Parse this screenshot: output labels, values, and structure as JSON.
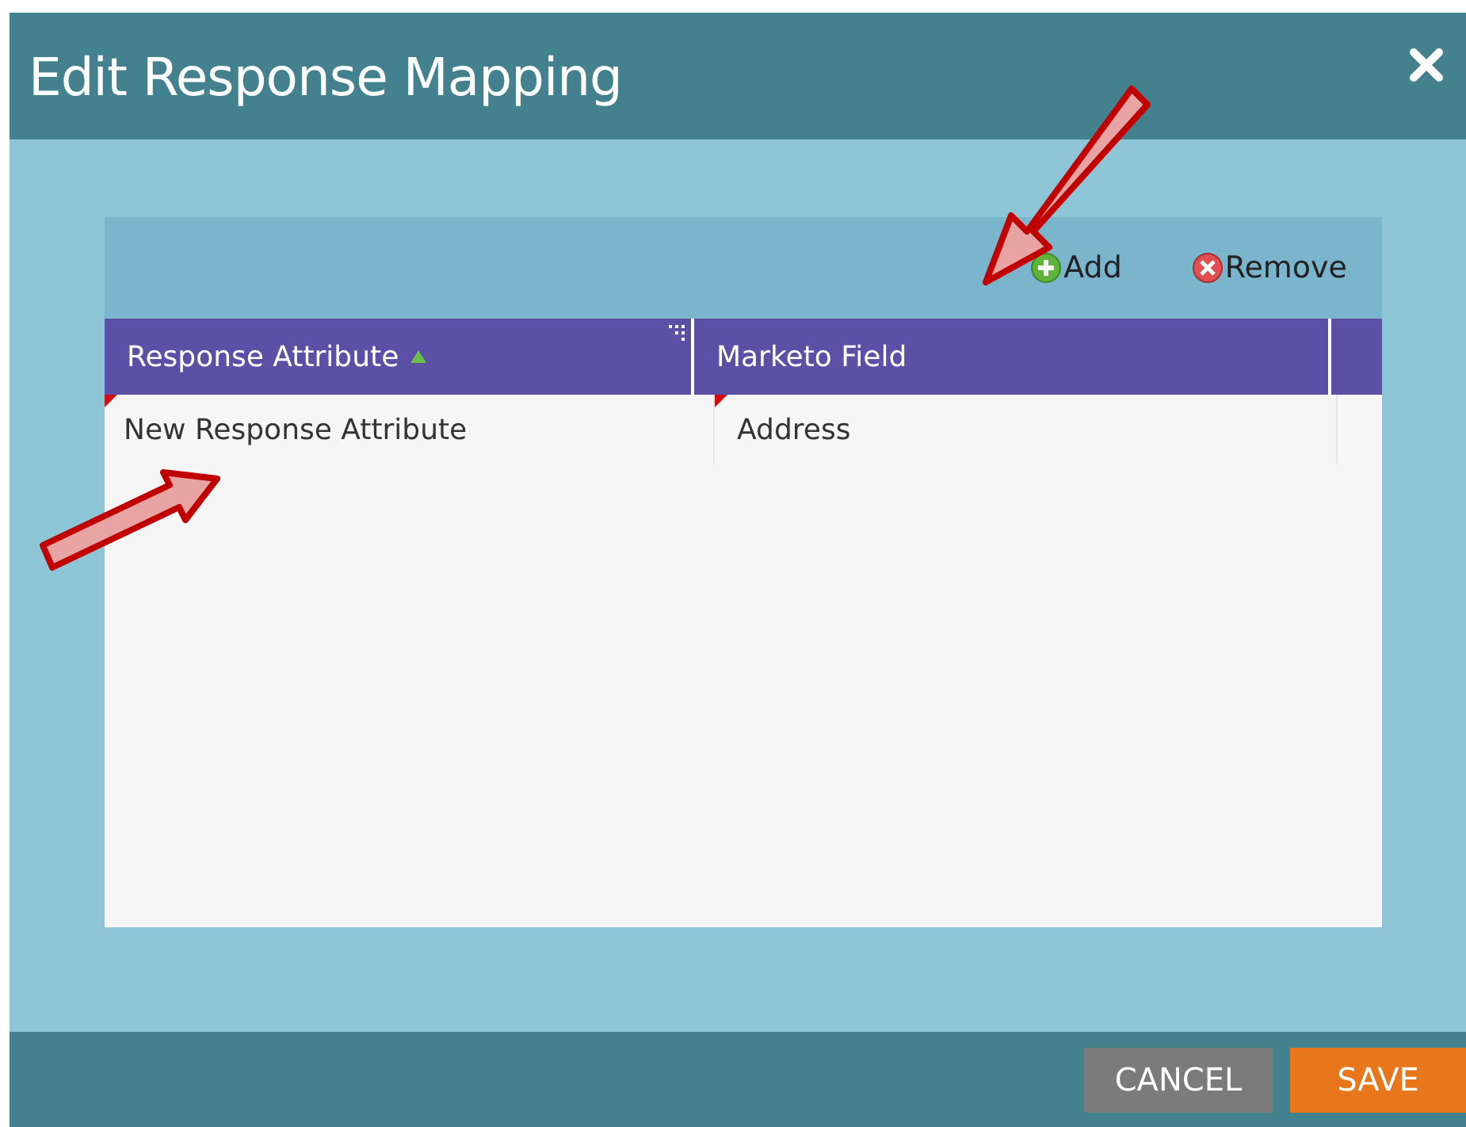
{
  "dialog": {
    "title": "Edit Response Mapping"
  },
  "toolbar": [
    {
      "kind": "add",
      "label": "Add"
    },
    {
      "kind": "remove",
      "label": "Remove"
    }
  ],
  "table": {
    "columns": [
      {
        "label": "Response Attribute",
        "sorted": true
      },
      {
        "label": "Marketo Field",
        "sorted": false
      }
    ],
    "rows": [
      {
        "cells": [
          {
            "text": "New Response Attribute",
            "modified": true
          },
          {
            "text": "Address",
            "modified": true
          }
        ]
      }
    ]
  },
  "buttons": [
    {
      "kind": "cancel",
      "label": "CANCEL"
    },
    {
      "kind": "save",
      "label": "SAVE"
    }
  ]
}
